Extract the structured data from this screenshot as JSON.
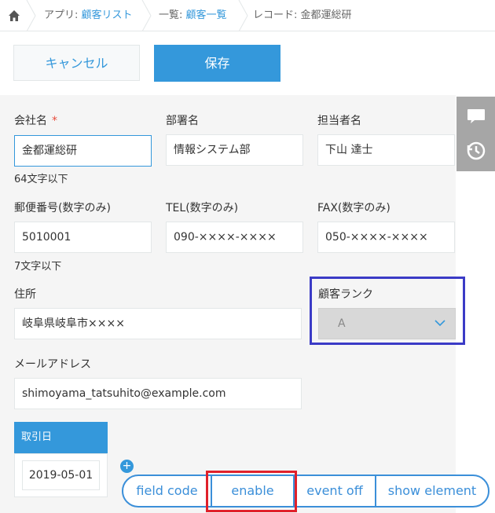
{
  "breadcrumb": {
    "app_prefix": "アプリ: ",
    "app_name": "顧客リスト",
    "list_prefix": "一覧: ",
    "list_name": "顧客一覧",
    "record_label": "レコード: 金都運総研"
  },
  "toolbar": {
    "cancel_label": "キャンセル",
    "save_label": "保存"
  },
  "form": {
    "company": {
      "label": "会社名",
      "required_mark": "*",
      "value": "金都運総研",
      "hint": "64文字以下"
    },
    "department": {
      "label": "部署名",
      "value": "情報システム部"
    },
    "person": {
      "label": "担当者名",
      "value": "下山 達士"
    },
    "postal": {
      "label": "郵便番号(数字のみ)",
      "value": "5010001",
      "hint": "7文字以下"
    },
    "tel": {
      "label": "TEL(数字のみ)",
      "value": "090-××××-××××"
    },
    "fax": {
      "label": "FAX(数字のみ)",
      "value": "050-××××-××××"
    },
    "address": {
      "label": "住所",
      "value": "岐阜県岐阜市××××"
    },
    "rank": {
      "label": "顧客ランク",
      "value": "A"
    },
    "email": {
      "label": "メールアドレス",
      "value": "shimoyama_tatsuhito@example.com"
    },
    "trade_date": {
      "label": "取引日",
      "value": "2019-05-01"
    },
    "add_row_symbol": "+"
  },
  "plugin_toolbar": {
    "field_code": "field code",
    "enable": "enable",
    "event_off": "event off",
    "show_element": "show element"
  },
  "colors": {
    "accent": "#3498db",
    "rank_highlight": "#3b3bc6",
    "enable_highlight": "#e0202a",
    "required": "#e74c3c"
  }
}
